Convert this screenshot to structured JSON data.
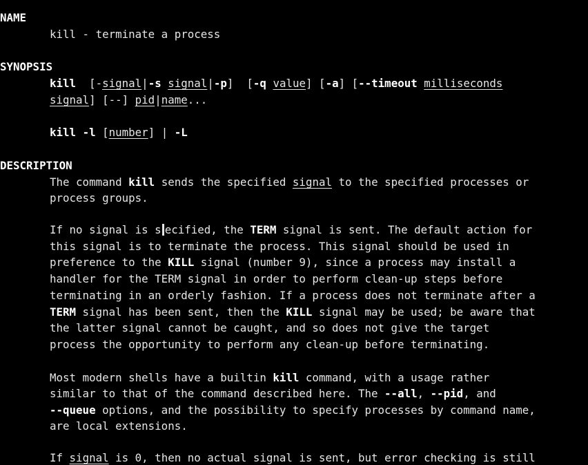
{
  "window": {
    "app": "man page viewer",
    "colors": {
      "background": "#000000",
      "text": "#e6e6e6",
      "bold": "#ffffff"
    }
  },
  "sections": {
    "name": "NAME",
    "synopsis": "SYNOPSIS",
    "description": "DESCRIPTION"
  },
  "lines": {
    "name_1": [
      {
        "t": "kill - terminate a process"
      }
    ],
    "syn_1": [
      {
        "t": "kill",
        "b": true
      },
      {
        "t": "  [-"
      },
      {
        "t": "signal",
        "u": true
      },
      {
        "t": "|"
      },
      {
        "t": "-s",
        "b": true
      },
      {
        "t": " "
      },
      {
        "t": "signal",
        "u": true
      },
      {
        "t": "|"
      },
      {
        "t": "-p",
        "b": true
      },
      {
        "t": "]  ["
      },
      {
        "t": "-q",
        "b": true
      },
      {
        "t": " "
      },
      {
        "t": "value",
        "u": true
      },
      {
        "t": "] ["
      },
      {
        "t": "-a",
        "b": true
      },
      {
        "t": "] ["
      },
      {
        "t": "--timeout",
        "b": true
      },
      {
        "t": " "
      },
      {
        "t": "milliseconds",
        "u": true
      }
    ],
    "syn_2": [
      {
        "t": "signal",
        "u": true
      },
      {
        "t": "] [--] "
      },
      {
        "t": "pid",
        "u": true
      },
      {
        "t": "|"
      },
      {
        "t": "name",
        "u": true
      },
      {
        "t": "..."
      }
    ],
    "syn_3": [
      {
        "t": "kill",
        "b": true
      },
      {
        "t": " "
      },
      {
        "t": "-l",
        "b": true
      },
      {
        "t": " ["
      },
      {
        "t": "number",
        "u": true
      },
      {
        "t": "] | "
      },
      {
        "t": "-L",
        "b": true
      }
    ],
    "desc_1": [
      {
        "t": "The command "
      },
      {
        "t": "kill",
        "b": true
      },
      {
        "t": " sends the specified "
      },
      {
        "t": "signal",
        "u": true
      },
      {
        "t": " to the specified processes or"
      }
    ],
    "desc_2": [
      {
        "t": "process groups."
      }
    ],
    "desc_3": [
      {
        "t": "If no signal is s"
      },
      {
        "cursor": true
      },
      {
        "t": "ecified, the "
      },
      {
        "t": "TERM",
        "b": true
      },
      {
        "t": " signal is sent. The default action for"
      }
    ],
    "desc_4": [
      {
        "t": "this signal is to terminate the process. This signal should be used in"
      }
    ],
    "desc_5": [
      {
        "t": "preference to the "
      },
      {
        "t": "KILL",
        "b": true
      },
      {
        "t": " signal (number 9), since a process may install a"
      }
    ],
    "desc_6": [
      {
        "t": "handler for the TERM signal in order to perform clean-up steps before"
      }
    ],
    "desc_7": [
      {
        "t": "terminating in an orderly fashion. If a process does not terminate after a"
      }
    ],
    "desc_8": [
      {
        "t": "TERM",
        "b": true
      },
      {
        "t": " signal has been sent, then the "
      },
      {
        "t": "KILL",
        "b": true
      },
      {
        "t": " signal may be used; be aware that"
      }
    ],
    "desc_9": [
      {
        "t": "the latter signal cannot be caught, and so does not give the target"
      }
    ],
    "desc_10": [
      {
        "t": "process the opportunity to perform any clean-up before terminating."
      }
    ],
    "desc_11": [
      {
        "t": "Most modern shells have a builtin "
      },
      {
        "t": "kill",
        "b": true
      },
      {
        "t": " command, with a usage rather"
      }
    ],
    "desc_12": [
      {
        "t": "similar to that of the command described here. The "
      },
      {
        "t": "--all",
        "b": true
      },
      {
        "t": ", "
      },
      {
        "t": "--pid",
        "b": true
      },
      {
        "t": ", and"
      }
    ],
    "desc_13": [
      {
        "t": "--queue",
        "b": true
      },
      {
        "t": " options, and the possibility to specify processes by command name,"
      }
    ],
    "desc_14": [
      {
        "t": "are local extensions."
      }
    ],
    "desc_15": [
      {
        "t": "If "
      },
      {
        "t": "signal",
        "u": true
      },
      {
        "t": " is 0, then no actual signal is sent, but error checking is still"
      }
    ]
  }
}
